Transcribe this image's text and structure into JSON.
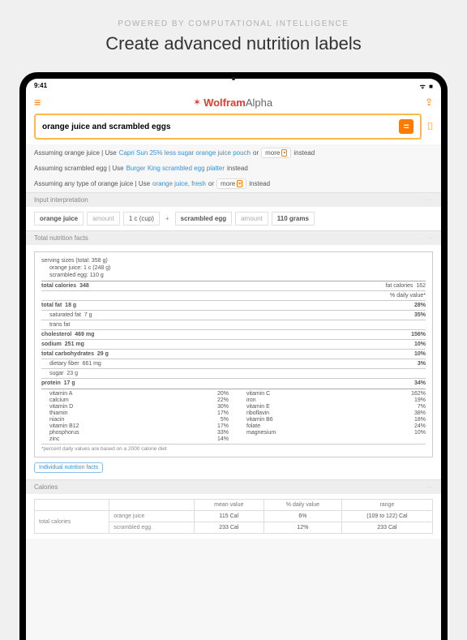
{
  "tagline": "POWERED BY COMPUTATIONAL INTELLIGENCE",
  "headline": "Create advanced nutrition labels",
  "statusbar": {
    "time": "9:41",
    "wifi": "ᯤ",
    "battery": "■"
  },
  "logo": {
    "wolfram": "Wolfram",
    "alpha": "Alpha"
  },
  "search": {
    "value": "orange juice and scrambled eggs"
  },
  "assumptions": {
    "a1_pre": "Assuming orange juice  |  Use",
    "a1_link": "Capri Sun 25% less sugar orange juice pouch",
    "a1_or": "or",
    "a1_instead": "instead",
    "a2_pre": "Assuming scrambled egg  |  Use",
    "a2_link": "Burger King scrambled egg platter",
    "a2_instead": "instead",
    "a3_pre": "Assuming any type of orange juice  |  Use",
    "a3_link": "orange juice, fresh",
    "a3_or": "or",
    "a3_instead": "instead",
    "more": "more"
  },
  "sections": {
    "interp": "Input interpretation",
    "nutrition": "Total nutrition facts",
    "calories": "Calories"
  },
  "interp": {
    "oj": "orange juice",
    "amount1": "amount",
    "cup": "1 c",
    "cuplabel": "(cup)",
    "plus": "+",
    "egg": "scrambled egg",
    "amount2": "amount",
    "grams": "110 grams"
  },
  "nfacts": {
    "serving_sizes": "serving sizes (total: 358 g)",
    "s_oj": "orange juice:  1 c (248 g)",
    "s_egg": "scrambled egg:  110 g",
    "totalcal_l": "total calories",
    "totalcal_v": "348",
    "fatcal_l": "fat calories",
    "fatcal_v": "162",
    "dailyval": "% daily value*",
    "rows": {
      "totalfat_l": "total fat",
      "totalfat_v": "18 g",
      "totalfat_p": "28%",
      "satfat_l": "saturated fat",
      "satfat_v": "7 g",
      "satfat_p": "35%",
      "transfat_l": "trans fat",
      "transfat_v": "",
      "transfat_p": "",
      "chol_l": "cholesterol",
      "chol_v": "469 mg",
      "chol_p": "156%",
      "sodium_l": "sodium",
      "sodium_v": "251 mg",
      "sodium_p": "10%",
      "carb_l": "total carbohydrates",
      "carb_v": "29 g",
      "carb_p": "10%",
      "fiber_l": "dietary fiber",
      "fiber_v": "661 mg",
      "fiber_p": "3%",
      "sugar_l": "sugar",
      "sugar_v": "23 g",
      "sugar_p": "",
      "protein_l": "protein",
      "protein_v": "17 g",
      "protein_p": "34%"
    },
    "vitamins": {
      "va_l": "vitamin A",
      "va_p": "20%",
      "vc_l": "vitamin C",
      "vc_p": "162%",
      "ca_l": "calcium",
      "ca_p": "22%",
      "fe_l": "iron",
      "fe_p": "19%",
      "vd_l": "vitamin D",
      "vd_p": "30%",
      "ve_l": "vitamin E",
      "ve_p": "7%",
      "th_l": "thiamin",
      "th_p": "17%",
      "rb_l": "riboflavin",
      "rb_p": "38%",
      "ni_l": "niacin",
      "ni_p": "5%",
      "b6_l": "vitamin B6",
      "b6_p": "18%",
      "b12_l": "vitamin B12",
      "b12_p": "17%",
      "fo_l": "folate",
      "fo_p": "24%",
      "ph_l": "phosphorus",
      "ph_p": "33%",
      "mg_l": "magnesium",
      "mg_p": "10%",
      "zn_l": "zinc",
      "zn_p": "14%"
    },
    "footnote": "*percent daily values are based on a 2000 calorie diet",
    "indiv": "Individual nutrition facts"
  },
  "calories": {
    "h_mean": "mean value",
    "h_daily": "% daily value",
    "h_range": "range",
    "rowh": "total calories",
    "r1_name": "orange juice",
    "r1_mean": "115 Cal",
    "r1_daily": "6%",
    "r1_range": "(109  to  122)  Cal",
    "r2_name": "scrambled egg",
    "r2_mean": "233 Cal",
    "r2_daily": "12%",
    "r2_range": "233 Cal"
  }
}
